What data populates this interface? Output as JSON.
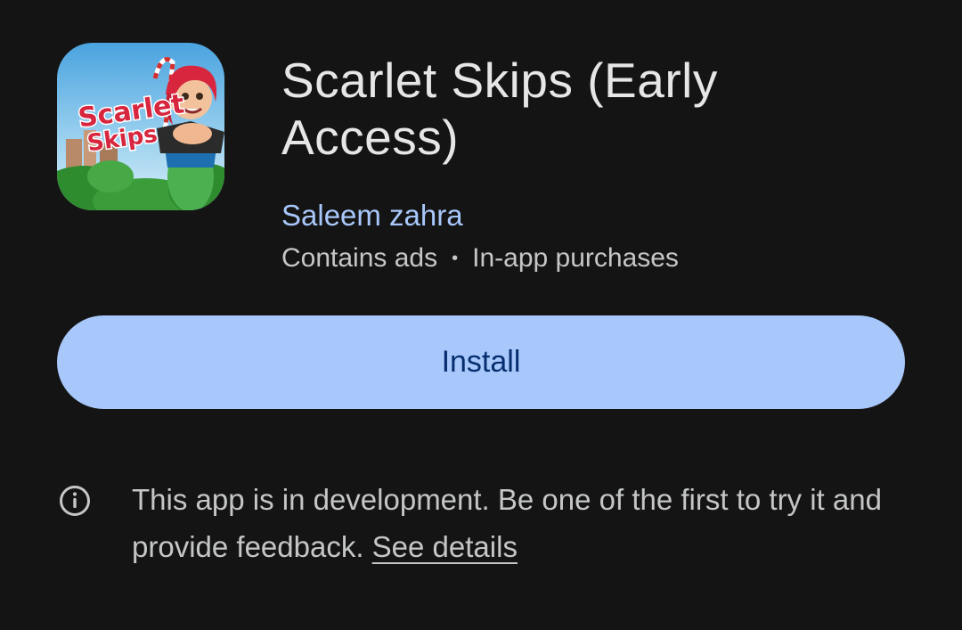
{
  "app": {
    "title": "Scarlet Skips (Early Access)",
    "developer": "Saleem zahra",
    "meta_ads": "Contains ads",
    "meta_separator": "•",
    "meta_iap": "In-app purchases",
    "icon_text_line1": "Scarlet",
    "icon_text_line2": "Skips"
  },
  "install": {
    "label": "Install"
  },
  "notice": {
    "text": "This app is in development. Be one of the first to try it and provide feedback. ",
    "link": "See details"
  },
  "colors": {
    "background": "#141414",
    "accent": "#a8c7fa",
    "button_text": "#062e6f",
    "secondary_text": "#c4c7c5"
  }
}
